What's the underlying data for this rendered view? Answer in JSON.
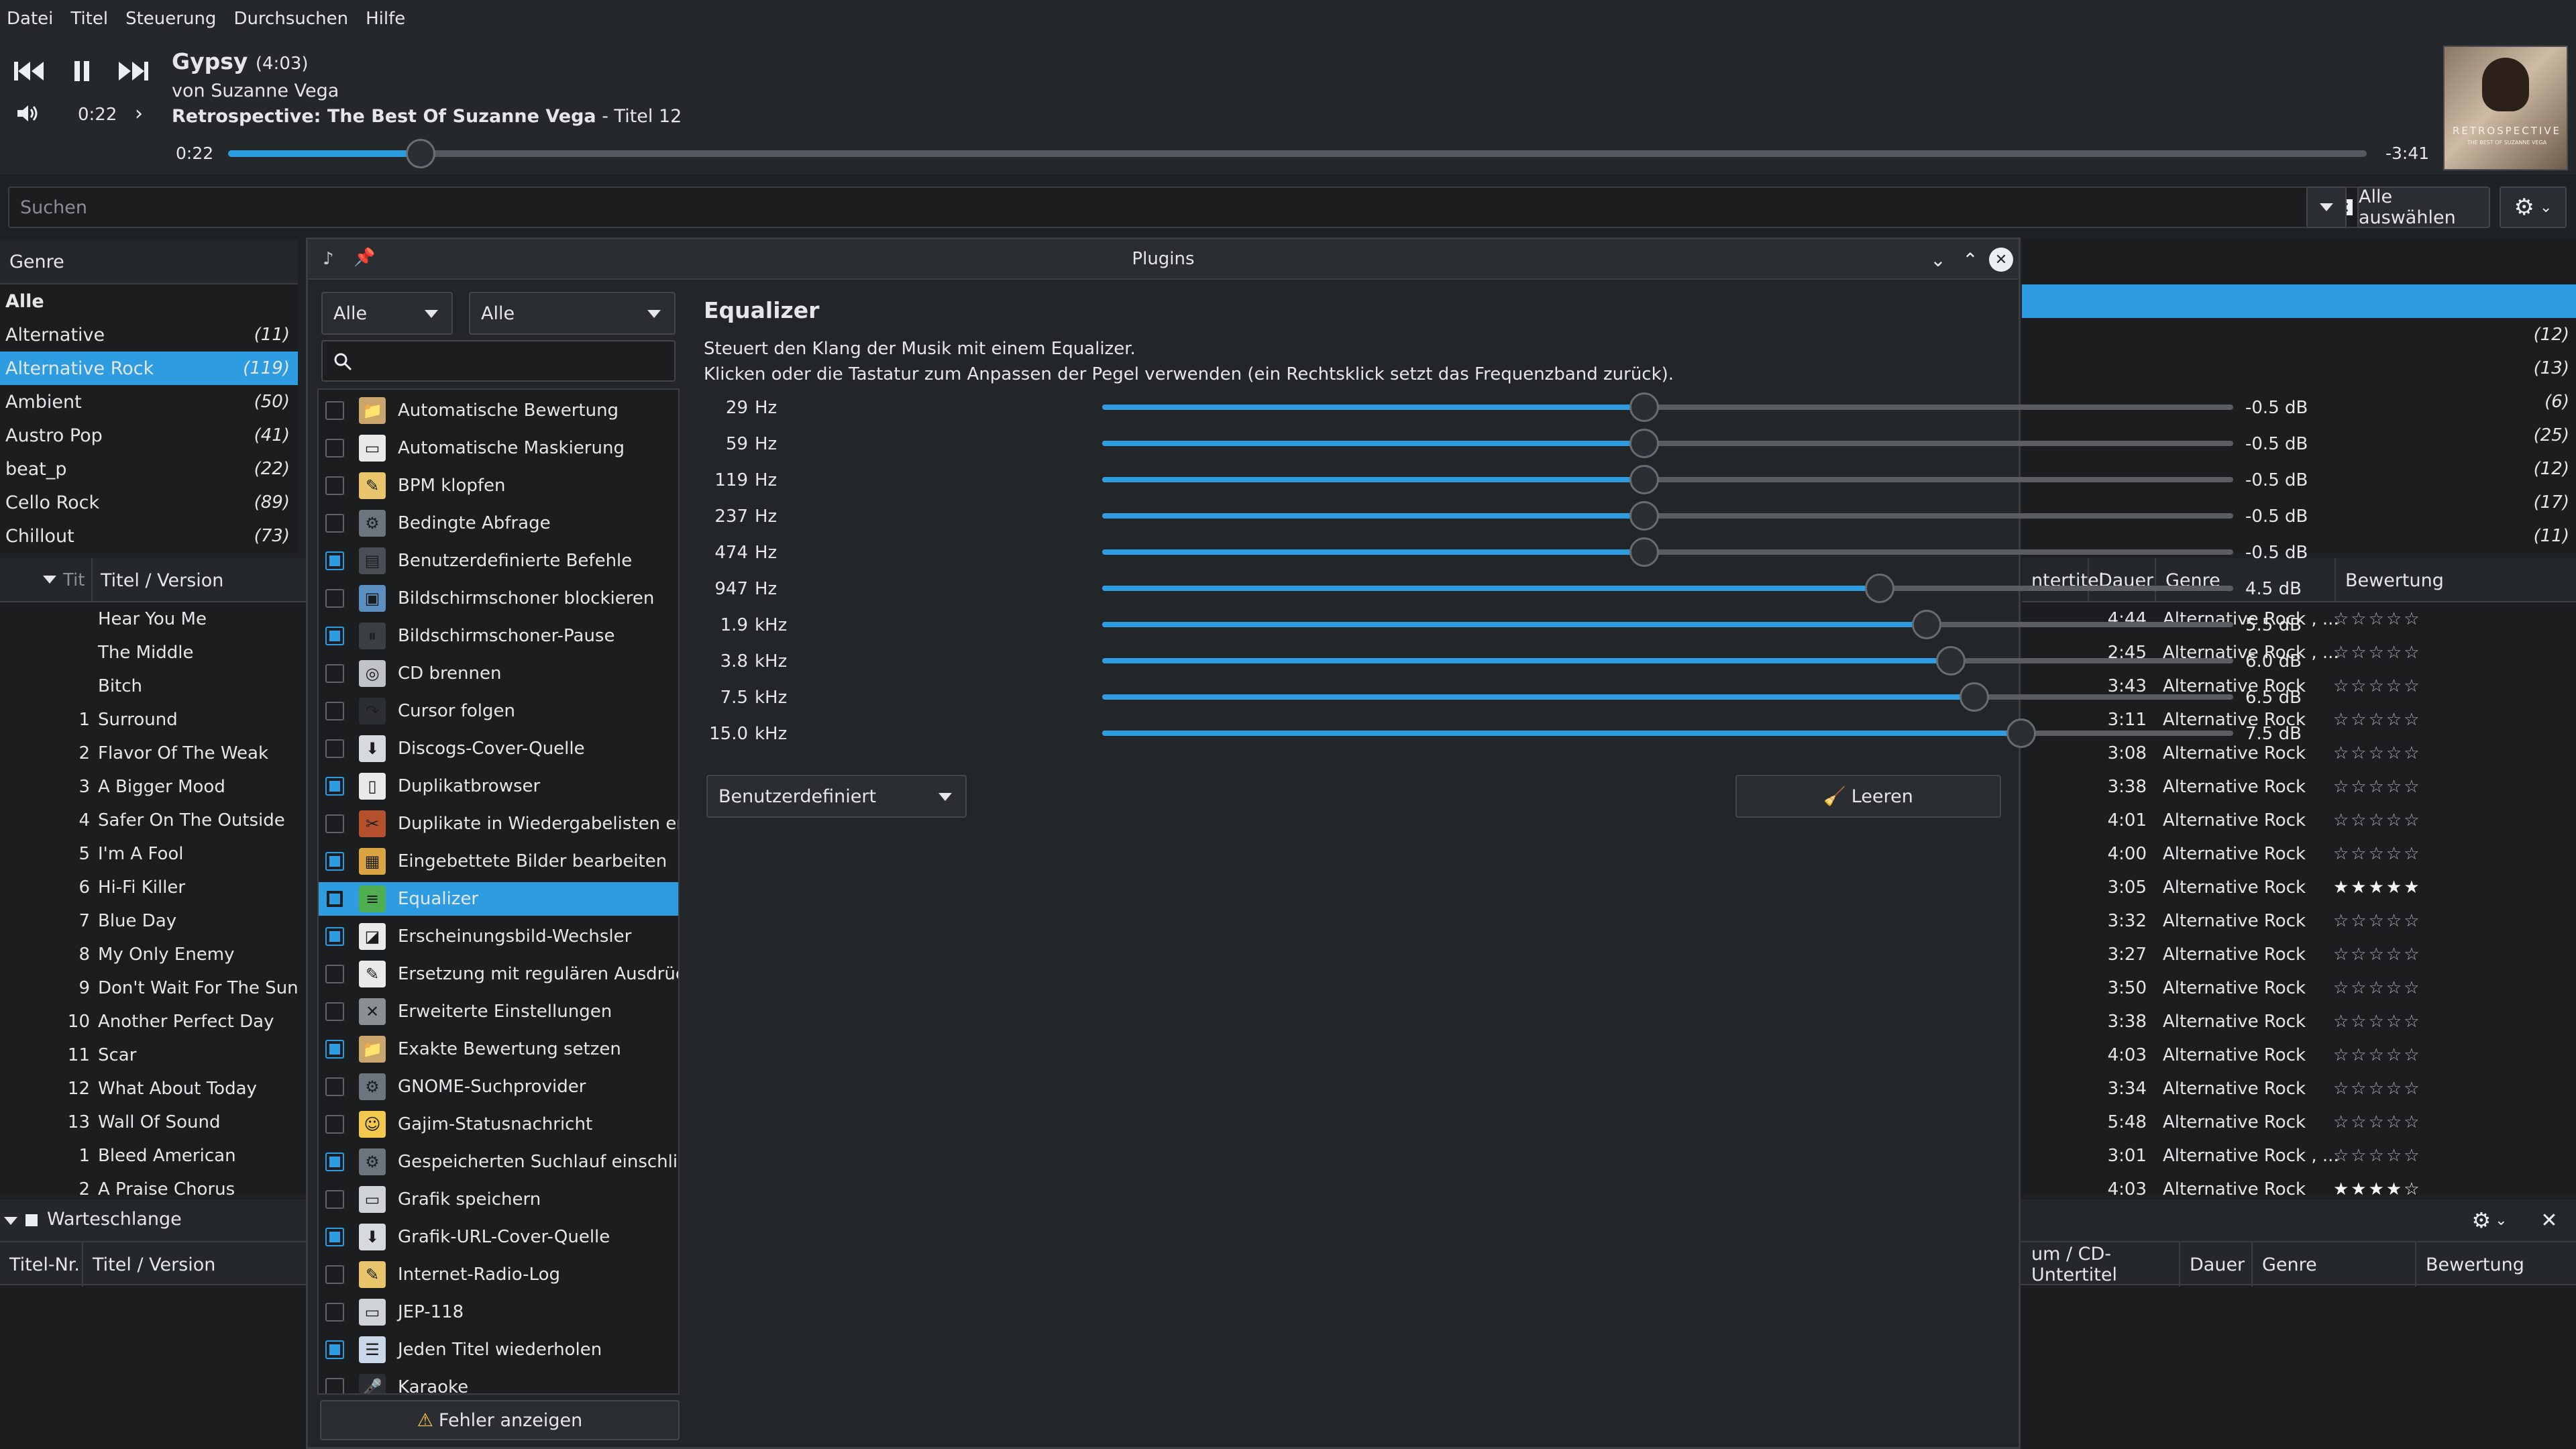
{
  "menu": [
    "Datei",
    "Titel",
    "Steuerung",
    "Durchsuchen",
    "Hilfe"
  ],
  "player": {
    "title": "Gypsy",
    "duration": "(4:03)",
    "artist": "von Suzanne Vega",
    "album": "Retrospective: The Best Of Suzanne Vega",
    "album_track": " - Titel 12",
    "elapsed_small": "0:22",
    "elapsed": "0:22",
    "remaining": "-3:41",
    "progress_fraction": 0.09,
    "cover_text": "RETROSPECTIVE",
    "cover_sub": "THE BEST OF SUZANNE VEGA"
  },
  "search": {
    "placeholder": "Suchen",
    "select_all": "Alle auswählen"
  },
  "genre": {
    "header": "Genre",
    "items": [
      {
        "name": "Alle",
        "count": ""
      },
      {
        "name": "Alternative",
        "count": "(11)"
      },
      {
        "name": "Alternative Rock",
        "count": "(119)"
      },
      {
        "name": "Ambient",
        "count": "(50)"
      },
      {
        "name": "Austro Pop",
        "count": "(41)"
      },
      {
        "name": "beat_p",
        "count": "(22)"
      },
      {
        "name": "Cello Rock",
        "count": "(89)"
      },
      {
        "name": "Chillout",
        "count": "(73)"
      }
    ],
    "right_counts": [
      "(12)",
      "(13)",
      "(6)",
      "(25)",
      "(12)",
      "(17)",
      "(11)"
    ]
  },
  "tracklist": {
    "col_short": "Tit",
    "col_title": "Titel / Version",
    "col_cd": "ntertitel",
    "col_dauer": "Dauer",
    "col_genre": "Genre",
    "col_rating": "Bewertung",
    "tracks": [
      {
        "nr": "",
        "title": "Hear You Me",
        "dauer": "4:44",
        "genre": "Alternative Rock , ...",
        "rating": "☆☆☆☆☆"
      },
      {
        "nr": "",
        "title": "The Middle",
        "dauer": "2:45",
        "genre": "Alternative Rock , ...",
        "rating": "☆☆☆☆☆"
      },
      {
        "nr": "",
        "title": "Bitch",
        "dauer": "3:43",
        "genre": "Alternative Rock",
        "rating": "☆☆☆☆☆"
      },
      {
        "nr": "1",
        "title": "Surround",
        "dauer": "3:11",
        "genre": "Alternative Rock",
        "rating": "☆☆☆☆☆"
      },
      {
        "nr": "2",
        "title": "Flavor Of The Weak",
        "dauer": "3:08",
        "genre": "Alternative Rock",
        "rating": "☆☆☆☆☆"
      },
      {
        "nr": "3",
        "title": "A Bigger Mood",
        "dauer": "3:38",
        "genre": "Alternative Rock",
        "rating": "☆☆☆☆☆"
      },
      {
        "nr": "4",
        "title": "Safer On The Outside",
        "dauer": "4:01",
        "genre": "Alternative Rock",
        "rating": "☆☆☆☆☆"
      },
      {
        "nr": "5",
        "title": "I'm A Fool",
        "dauer": "4:00",
        "genre": "Alternative Rock",
        "rating": "☆☆☆☆☆"
      },
      {
        "nr": "6",
        "title": "Hi-Fi Killer",
        "dauer": "3:05",
        "genre": "Alternative Rock",
        "rating": "★★★★★"
      },
      {
        "nr": "7",
        "title": "Blue Day",
        "dauer": "3:32",
        "genre": "Alternative Rock",
        "rating": "☆☆☆☆☆"
      },
      {
        "nr": "8",
        "title": "My Only Enemy",
        "dauer": "3:27",
        "genre": "Alternative Rock",
        "rating": "☆☆☆☆☆"
      },
      {
        "nr": "9",
        "title": "Don't Wait For The Sun",
        "dauer": "3:50",
        "genre": "Alternative Rock",
        "rating": "☆☆☆☆☆"
      },
      {
        "nr": "10",
        "title": "Another Perfect Day",
        "dauer": "3:38",
        "genre": "Alternative Rock",
        "rating": "☆☆☆☆☆"
      },
      {
        "nr": "11",
        "title": "Scar",
        "dauer": "4:03",
        "genre": "Alternative Rock",
        "rating": "☆☆☆☆☆"
      },
      {
        "nr": "12",
        "title": "What About Today",
        "dauer": "3:34",
        "genre": "Alternative Rock",
        "rating": "☆☆☆☆☆"
      },
      {
        "nr": "13",
        "title": "Wall Of Sound",
        "dauer": "5:48",
        "genre": "Alternative Rock",
        "rating": "☆☆☆☆☆"
      },
      {
        "nr": "1",
        "title": "Bleed American",
        "dauer": "3:01",
        "genre": "Alternative Rock , ...",
        "rating": "☆☆☆☆☆"
      },
      {
        "nr": "2",
        "title": "A Praise Chorus",
        "dauer": "4:03",
        "genre": "Alternative Rock",
        "rating": "★★★★☆"
      }
    ]
  },
  "queue": {
    "title": "Warteschlange",
    "col_nr": "Titel-Nr.",
    "col_title": "Titel / Version",
    "col_cd": "um / CD-Untertitel",
    "col_dauer": "Dauer",
    "col_genre": "Genre",
    "col_rating": "Bewertung"
  },
  "plugins": {
    "window_title": "Plugins",
    "filter1": "Alle",
    "filter2": "Alle",
    "show_errors": "Fehler anzeigen",
    "list": [
      {
        "name": "Automatische Bewertung",
        "on": false,
        "icon": "📁",
        "color": "#c9a66b"
      },
      {
        "name": "Automatische Maskierung",
        "on": false,
        "icon": "▭",
        "color": "#e9e9e9"
      },
      {
        "name": "BPM klopfen",
        "on": false,
        "icon": "✎",
        "color": "#e9c46a"
      },
      {
        "name": "Bedingte Abfrage",
        "on": false,
        "icon": "⚙",
        "color": "#6c757d"
      },
      {
        "name": "Benutzerdefinierte Befehle",
        "on": true,
        "icon": "▤",
        "color": "#4a4f55"
      },
      {
        "name": "Bildschirmschoner blockieren",
        "on": false,
        "icon": "▣",
        "color": "#5b8fbf"
      },
      {
        "name": "Bildschirmschoner-Pause",
        "on": true,
        "icon": "⏸",
        "color": "#3a3f44"
      },
      {
        "name": "CD brennen",
        "on": false,
        "icon": "◎",
        "color": "#bfc3c7"
      },
      {
        "name": "Cursor folgen",
        "on": false,
        "icon": "↷",
        "color": "#2b2f33"
      },
      {
        "name": "Discogs-Cover-Quelle",
        "on": false,
        "icon": "⬇",
        "color": "#d7dadd"
      },
      {
        "name": "Duplikatbrowser",
        "on": true,
        "icon": "▯",
        "color": "#e9e9e9"
      },
      {
        "name": "Duplikate in Wiedergabelisten ent...",
        "on": false,
        "icon": "✂",
        "color": "#b5502c"
      },
      {
        "name": "Eingebettete Bilder bearbeiten",
        "on": true,
        "icon": "▦",
        "color": "#d9a441"
      },
      {
        "name": "Equalizer",
        "on": true,
        "icon": "≡",
        "color": "#4fae4f"
      },
      {
        "name": "Erscheinungsbild-Wechsler",
        "on": true,
        "icon": "◪",
        "color": "#e9e9e9"
      },
      {
        "name": "Ersetzung mit regulären Ausdrüc...",
        "on": false,
        "icon": "✎",
        "color": "#e9e9e9"
      },
      {
        "name": "Erweiterte Einstellungen",
        "on": false,
        "icon": "✕",
        "color": "#8a8f94"
      },
      {
        "name": "Exakte Bewertung setzen",
        "on": true,
        "icon": "📁",
        "color": "#c9a66b"
      },
      {
        "name": "GNOME-Suchprovider",
        "on": false,
        "icon": "⚙",
        "color": "#6c757d"
      },
      {
        "name": "Gajim-Statusnachricht",
        "on": false,
        "icon": "☺",
        "color": "#f2c94c"
      },
      {
        "name": "Gespeicherten Suchlauf einschließ...",
        "on": true,
        "icon": "⚙",
        "color": "#6c757d"
      },
      {
        "name": "Grafik speichern",
        "on": false,
        "icon": "▭",
        "color": "#cfd3d7"
      },
      {
        "name": "Grafik-URL-Cover-Quelle",
        "on": true,
        "icon": "⬇",
        "color": "#d7dadd"
      },
      {
        "name": "Internet-Radio-Log",
        "on": false,
        "icon": "✎",
        "color": "#e9c46a"
      },
      {
        "name": "JEP-118",
        "on": false,
        "icon": "▭",
        "color": "#cfd3d7"
      },
      {
        "name": "Jeden Titel wiederholen",
        "on": true,
        "icon": "☰",
        "color": "#c9d7e8"
      },
      {
        "name": "Karaoke",
        "on": false,
        "icon": "🎤",
        "color": "#2b2f33"
      }
    ],
    "selected_index": 13
  },
  "equalizer": {
    "title": "Equalizer",
    "desc1": "Steuert den Klang der Musik mit einem Equalizer.",
    "desc2": "Klicken oder die Tastatur zum Anpassen der Pegel verwenden (ein Rechtsklick setzt das Frequenzband zurück).",
    "preset": "Benutzerdefiniert",
    "clear_button": "Leeren",
    "range_db": [
      -12,
      12
    ],
    "bands": [
      {
        "freq": "29",
        "unit": "Hz",
        "db": -0.5,
        "label": "-0.5 dB"
      },
      {
        "freq": "59",
        "unit": "Hz",
        "db": -0.5,
        "label": "-0.5 dB"
      },
      {
        "freq": "119",
        "unit": "Hz",
        "db": -0.5,
        "label": "-0.5 dB"
      },
      {
        "freq": "237",
        "unit": "Hz",
        "db": -0.5,
        "label": "-0.5 dB"
      },
      {
        "freq": "474",
        "unit": "Hz",
        "db": -0.5,
        "label": "-0.5 dB"
      },
      {
        "freq": "947",
        "unit": "Hz",
        "db": 4.5,
        "label": "4.5 dB"
      },
      {
        "freq": "1.9",
        "unit": "kHz",
        "db": 5.5,
        "label": "5.5 dB"
      },
      {
        "freq": "3.8",
        "unit": "kHz",
        "db": 6.0,
        "label": "6.0 dB"
      },
      {
        "freq": "7.5",
        "unit": "kHz",
        "db": 6.5,
        "label": "6.5 dB"
      },
      {
        "freq": "15.0",
        "unit": "kHz",
        "db": 7.5,
        "label": "7.5 dB"
      }
    ]
  }
}
